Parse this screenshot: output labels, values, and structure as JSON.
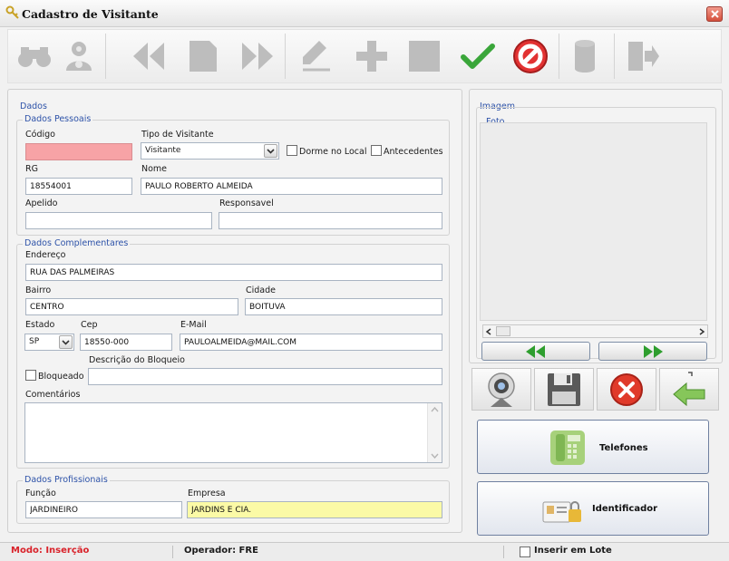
{
  "window": {
    "title": "Cadastro de Visitante"
  },
  "toolbar": {
    "buttons": [
      {
        "name": "search-button",
        "icon": "binoculars-icon",
        "enabled": false
      },
      {
        "name": "settings-button",
        "icon": "gear-person-icon",
        "enabled": false
      },
      {
        "name": "previous-button",
        "icon": "rewind-icon",
        "enabled": false
      },
      {
        "name": "page-button",
        "icon": "page-icon",
        "enabled": false
      },
      {
        "name": "next-button",
        "icon": "fast-forward-icon",
        "enabled": false
      },
      {
        "name": "edit-button",
        "icon": "pen-icon",
        "enabled": false
      },
      {
        "name": "add-button",
        "icon": "plus-icon",
        "enabled": false
      },
      {
        "name": "stop-button",
        "icon": "square-icon",
        "enabled": false
      },
      {
        "name": "confirm-button",
        "icon": "check-icon",
        "enabled": true
      },
      {
        "name": "cancel-button",
        "icon": "no-entry-icon",
        "enabled": true
      },
      {
        "name": "database-button",
        "icon": "cylinder-icon",
        "enabled": false
      },
      {
        "name": "exit-button",
        "icon": "door-exit-icon",
        "enabled": false
      }
    ]
  },
  "dados": {
    "legend": "Dados",
    "pessoais": {
      "legend": "Dados Pessoais",
      "codigo_label": "Código",
      "codigo_value": "",
      "tipo_label": "Tipo de Visitante",
      "tipo_value": "Visitante",
      "dorme_label": "Dorme no Local",
      "antecedentes_label": "Antecedentes",
      "rg_label": "RG",
      "rg_value": "18554001",
      "nome_label": "Nome",
      "nome_value": "PAULO ROBERTO ALMEIDA",
      "apelido_label": "Apelido",
      "apelido_value": "",
      "responsavel_label": "Responsavel",
      "responsavel_value": ""
    },
    "complementares": {
      "legend": "Dados Complementares",
      "endereco_label": "Endereço",
      "endereco_value": "RUA DAS PALMEIRAS",
      "bairro_label": "Bairro",
      "bairro_value": "CENTRO",
      "cidade_label": "Cidade",
      "cidade_value": "BOITUVA",
      "estado_label": "Estado",
      "estado_value": "SP",
      "cep_label": "Cep",
      "cep_value": "18550-000",
      "email_label": "E-Mail",
      "email_value": "PAULOALMEIDA@MAIL.COM",
      "bloqueado_label": "Bloqueado",
      "desc_bloqueio_label": "Descrição do Bloqueio",
      "desc_bloqueio_value": "",
      "comentarios_label": "Comentários",
      "comentarios_value": ""
    },
    "profissionais": {
      "legend": "Dados Profissionais",
      "funcao_label": "Função",
      "funcao_value": "JARDINEIRO",
      "empresa_label": "Empresa",
      "empresa_value": "JARDINS E CIA."
    }
  },
  "imagem": {
    "legend": "Imagem",
    "foto_legend": "Foto",
    "scroll_icon": "grip-icon",
    "image_buttons": [
      {
        "name": "webcam-button",
        "icon": "webcam-icon"
      },
      {
        "name": "save-image-button",
        "icon": "floppy-icon"
      },
      {
        "name": "delete-image-button",
        "icon": "red-x-icon"
      },
      {
        "name": "import-image-button",
        "icon": "green-arrow-icon"
      }
    ]
  },
  "actions": {
    "telefones_label": "Telefones",
    "identificador_label": "Identificador"
  },
  "status": {
    "modo": "Modo: Inserção",
    "operador": "Operador: FRE",
    "inserir_lote": "Inserir em Lote"
  },
  "colors": {
    "modo_text": "#d9222a",
    "legend_text": "#2d52a8",
    "codigo_bg": "#f7a3a6",
    "empresa_bg": "#fbfaa6",
    "nav_arrow": "#2e9e2e"
  }
}
